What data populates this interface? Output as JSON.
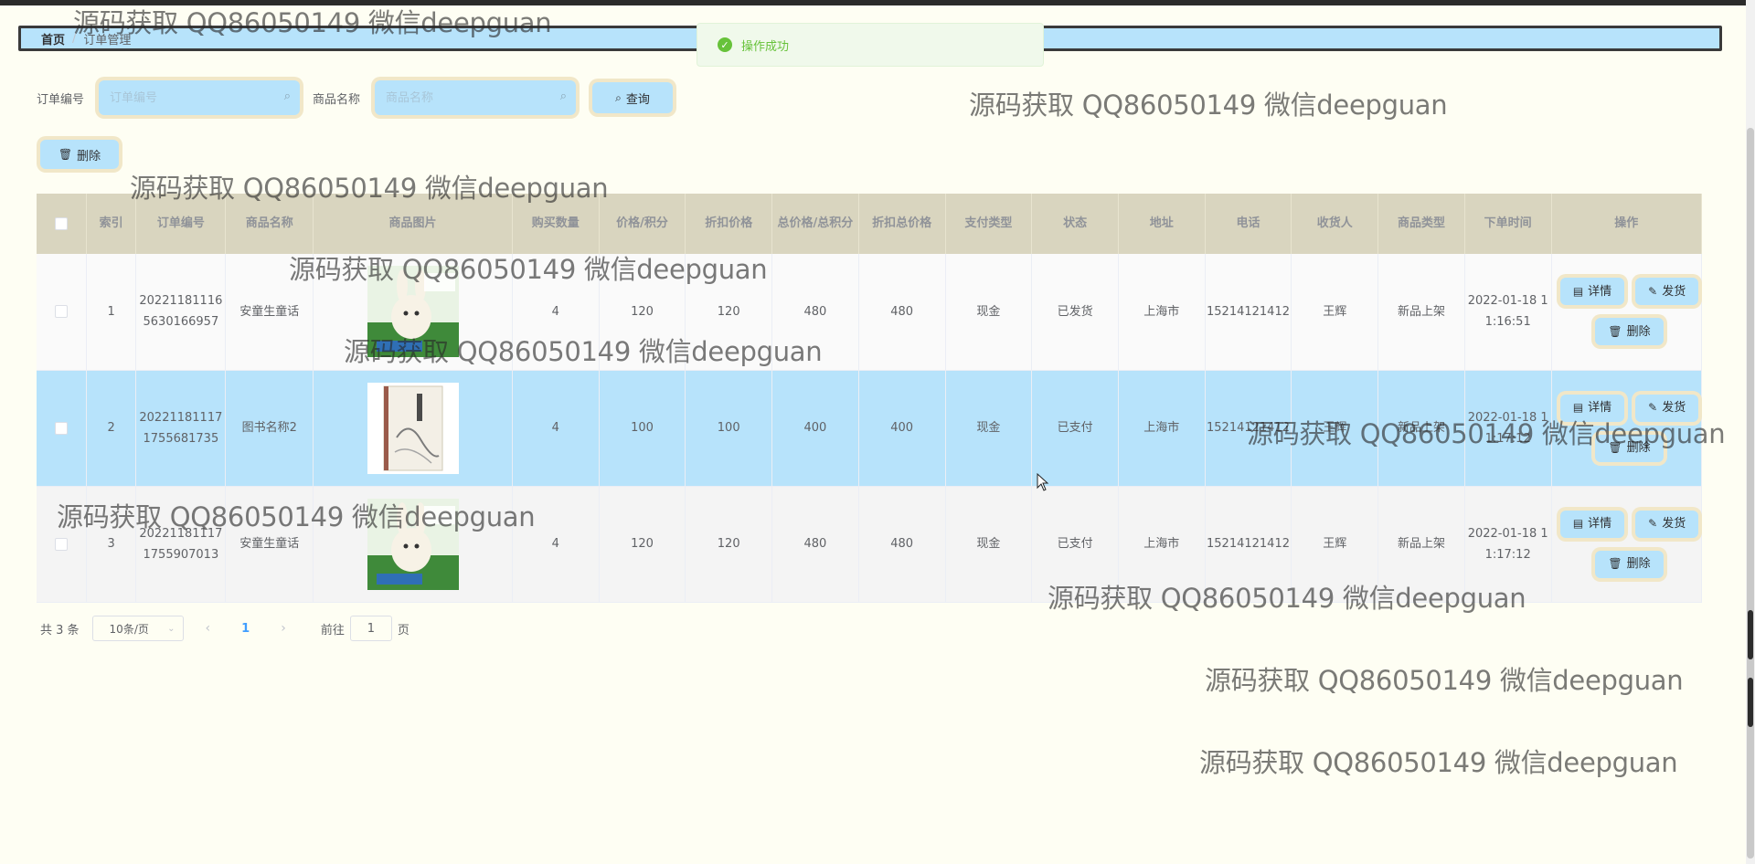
{
  "breadcrumb": {
    "home": "首页",
    "current": "订单管理"
  },
  "toast": {
    "message": "操作成功",
    "color": "#67c23a"
  },
  "search": {
    "order_no_label": "订单编号",
    "order_no_placeholder": "订单编号",
    "product_label": "商品名称",
    "product_placeholder": "商品名称",
    "search_button": "查询",
    "search_icon": "search-icon"
  },
  "toolbar": {
    "delete_button": "删除",
    "delete_icon": "trash-icon"
  },
  "table": {
    "headers": [
      "索引",
      "订单编号",
      "商品名称",
      "商品图片",
      "购买数量",
      "价格/积分",
      "折扣价格",
      "总价格/总积分",
      "折扣总价格",
      "支付类型",
      "状态",
      "地址",
      "电话",
      "收货人",
      "商品类型",
      "下单时间",
      "操作"
    ],
    "actions": {
      "detail": "详情",
      "ship": "发货",
      "delete": "删除"
    },
    "rows": [
      {
        "index": "1",
        "order_no": "202211811165630166957",
        "name": "安童生童话",
        "qty": "4",
        "price": "120",
        "discount": "120",
        "total": "480",
        "discount_total": "480",
        "pay": "现金",
        "status": "已发货",
        "addr": "上海市",
        "phone": "15214121412",
        "receiver": "王辉",
        "type": "新品上架",
        "time": "2022-01-18 11:16:51"
      },
      {
        "index": "2",
        "order_no": "202211811171755681735",
        "name": "图书名称2",
        "qty": "4",
        "price": "100",
        "discount": "100",
        "total": "400",
        "discount_total": "400",
        "pay": "现金",
        "status": "已支付",
        "addr": "上海市",
        "phone": "15214121412",
        "receiver": "王辉",
        "type": "新品上架",
        "time": "2022-01-18 11:17:12"
      },
      {
        "index": "3",
        "order_no": "202211811171755907013",
        "name": "安童生童话",
        "qty": "4",
        "price": "120",
        "discount": "120",
        "total": "480",
        "discount_total": "480",
        "pay": "现金",
        "status": "已支付",
        "addr": "上海市",
        "phone": "15214121412",
        "receiver": "王辉",
        "type": "新品上架",
        "time": "2022-01-18 11:17:12"
      }
    ]
  },
  "pagination": {
    "total": "共 3 条",
    "page_size": "10条/页",
    "current": "1",
    "goto_prefix": "前往",
    "goto_value": "1",
    "goto_suffix": "页"
  },
  "watermark": "源码获取 QQ86050149 微信deepguan",
  "colors": {
    "accent": "#b7e3fb",
    "background": "#fefef3",
    "header": "#d9d5bf",
    "highlight_border": "#f1e7c8"
  }
}
